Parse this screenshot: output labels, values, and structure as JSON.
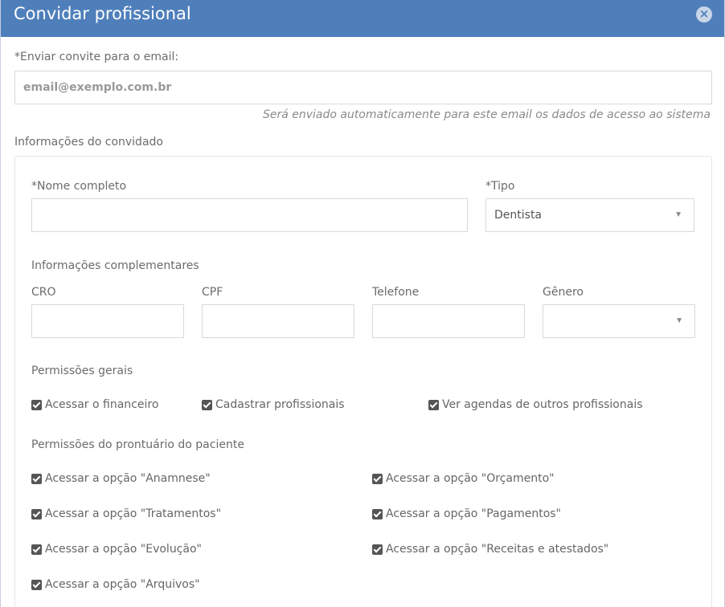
{
  "modal": {
    "title": "Convidar profissional",
    "close_glyph": "×"
  },
  "email": {
    "label": "*Enviar convite para o email:",
    "placeholder": "email@exemplo.com.br",
    "hint": "Será enviado automaticamente para este email os dados de acesso ao sistema"
  },
  "guest_section": {
    "title": "Informações do convidado"
  },
  "name": {
    "label": "*Nome completo",
    "value": ""
  },
  "type": {
    "label": "*Tipo",
    "value": "Dentista",
    "caret": "▼"
  },
  "complementary": {
    "title": "Informações complementares",
    "cro_label": "CRO",
    "cpf_label": "CPF",
    "phone_label": "Telefone",
    "gender_label": "Gênero",
    "gender_caret": "▼"
  },
  "general_permissions": {
    "title": "Permissões gerais",
    "items": [
      {
        "label": "Acessar o financeiro",
        "checked": true
      },
      {
        "label": "Cadastrar profissionais",
        "checked": true
      },
      {
        "label": "Ver agendas de outros profissionais",
        "checked": true
      }
    ]
  },
  "record_permissions": {
    "title": "Permissões do prontuário do paciente",
    "items": [
      {
        "label": "Acessar a opção \"Anamnese\"",
        "checked": true
      },
      {
        "label": "Acessar a opção \"Orçamento\"",
        "checked": true
      },
      {
        "label": "Acessar a opção \"Tratamentos\"",
        "checked": true
      },
      {
        "label": "Acessar a opção \"Pagamentos\"",
        "checked": true
      },
      {
        "label": "Acessar a opção \"Evolução\"",
        "checked": true
      },
      {
        "label": "Acessar a opção \"Receitas e atestados\"",
        "checked": true
      },
      {
        "label": "Acessar a opção \"Arquivos\"",
        "checked": true
      }
    ]
  },
  "colors": {
    "header": "#4f7fbb",
    "checkbox": "#555555"
  },
  "icons": {
    "close": "close-icon",
    "dropdown": "chevron-down-icon",
    "checkbox": "checkbox-checked-icon"
  }
}
